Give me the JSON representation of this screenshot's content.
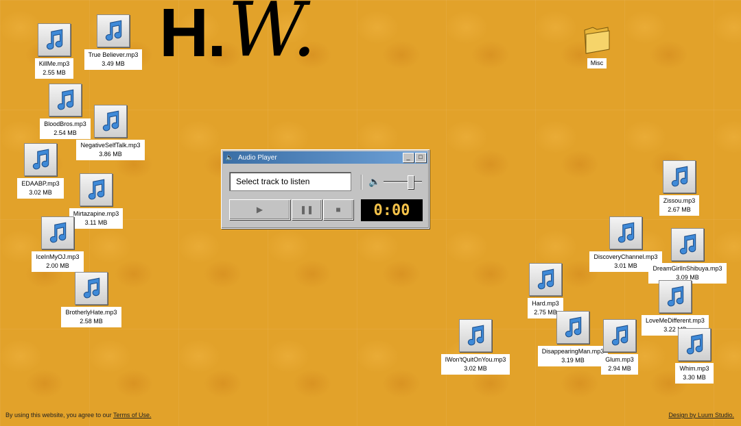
{
  "logo": {
    "letters_left": "H.",
    "letters_right": "W."
  },
  "desktop": {
    "files": [
      {
        "name": "KillMe.mp3",
        "size": "2.55 MB"
      },
      {
        "name": "True Believer.mp3",
        "size": "3.49 MB"
      },
      {
        "name": "BloodBros.mp3",
        "size": "2.54 MB"
      },
      {
        "name": "NegativeSelfTalk.mp3",
        "size": "3.86 MB"
      },
      {
        "name": "EDAABP.mp3",
        "size": "3.02 MB"
      },
      {
        "name": "Mirtazapine.mp3",
        "size": "3.11 MB"
      },
      {
        "name": "IceInMyOJ.mp3",
        "size": "2.00 MB"
      },
      {
        "name": "BrotherlyHate.mp3",
        "size": "2.58 MB"
      },
      {
        "name": "Zissou.mp3",
        "size": "2.67 MB"
      },
      {
        "name": "DiscoveryChannel.mp3",
        "size": "3.01 MB"
      },
      {
        "name": "DreamGirlInShibuya.mp3",
        "size": "3.09 MB"
      },
      {
        "name": "Hard.mp3",
        "size": "2.75 MB"
      },
      {
        "name": "LoveMeDifferent.mp3",
        "size": "3.22 MB"
      },
      {
        "name": "DisappearingMan.mp3",
        "size": "3.19 MB"
      },
      {
        "name": "Glum.mp3",
        "size": "2.94 MB"
      },
      {
        "name": "IWon'tQuitOnYou.mp3",
        "size": "3.02 MB"
      },
      {
        "name": "Whim.mp3",
        "size": "3.30 MB"
      }
    ],
    "folder": {
      "name": "Misc"
    }
  },
  "player": {
    "title": "Audio Player",
    "track_placeholder": "Select track to listen",
    "time": "0:00",
    "volume_level": 0.75,
    "play_symbol": "▶",
    "pause_symbol": "❚❚",
    "stop_symbol": "■",
    "minimize_symbol": "_",
    "maximize_symbol": "□"
  },
  "footer": {
    "consent_text": "By using this website, you agree to our ",
    "terms_link": "Terms of Use.",
    "credit_link": "Design by Luum Studio."
  },
  "colors": {
    "background": "#e2a22a",
    "titlebar": "#3a6ea5",
    "time_text": "#f4c24a"
  }
}
